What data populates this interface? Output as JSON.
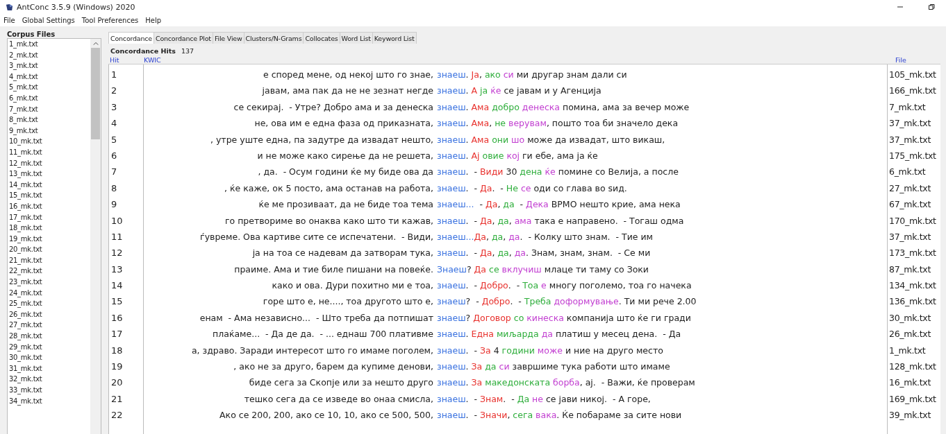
{
  "window": {
    "title": "AntConc 3.5.9 (Windows) 2020"
  },
  "menu": [
    "File",
    "Global Settings",
    "Tool Preferences",
    "Help"
  ],
  "corpus_files": {
    "title": "Corpus Files",
    "items": [
      "1_mk.txt",
      "2_mk.txt",
      "3_mk.txt",
      "4_mk.txt",
      "5_mk.txt",
      "6_mk.txt",
      "7_mk.txt",
      "8_mk.txt",
      "9_mk.txt",
      "10_mk.txt",
      "11_mk.txt",
      "12_mk.txt",
      "13_mk.txt",
      "14_mk.txt",
      "15_mk.txt",
      "16_mk.txt",
      "17_mk.txt",
      "18_mk.txt",
      "19_mk.txt",
      "20_mk.txt",
      "21_mk.txt",
      "22_mk.txt",
      "23_mk.txt",
      "24_mk.txt",
      "25_mk.txt",
      "26_mk.txt",
      "27_mk.txt",
      "28_mk.txt",
      "29_mk.txt",
      "30_mk.txt",
      "31_mk.txt",
      "32_mk.txt",
      "33_mk.txt",
      "34_mk.txt"
    ]
  },
  "tabs": [
    {
      "label": "Concordance",
      "selected": true
    },
    {
      "label": "Concordance Plot",
      "selected": false
    },
    {
      "label": "File View",
      "selected": false
    },
    {
      "label": "Clusters/N-Grams",
      "selected": false
    },
    {
      "label": "Collocates",
      "selected": false
    },
    {
      "label": "Word List",
      "selected": false
    },
    {
      "label": "Keyword List",
      "selected": false
    }
  ],
  "hits": {
    "label": "Concordance Hits",
    "count": "137"
  },
  "columns": [
    "Hit",
    "KWIC",
    "File"
  ],
  "rows": [
    {
      "hit": "1",
      "left": "е според мене, од некој што го знае,",
      "node": "знаеш",
      "file": "105_mk.txt",
      "right": [
        {
          "text": ". "
        },
        {
          "text": "Ја",
          "color": "#e8322e"
        },
        {
          "text": ", "
        },
        {
          "text": "ако",
          "color": "#2fae3c"
        },
        {
          "text": " си",
          "color": "#c23fd1"
        },
        {
          "text": " ми другар знам дали си"
        }
      ]
    },
    {
      "hit": "2",
      "left": "јавам, ама пак да не не зезнат негде",
      "node": "знаеш",
      "file": "166_mk.txt",
      "right": [
        {
          "text": ". "
        },
        {
          "text": "А",
          "color": "#e8322e"
        },
        {
          "text": " ја",
          "color": "#2fae3c"
        },
        {
          "text": " ќе",
          "color": "#c23fd1"
        },
        {
          "text": " се јавам и у Агенција"
        }
      ]
    },
    {
      "hit": "3",
      "left": "се секирај.  - Утре? Добро ама и за денеска",
      "node": "знаеш",
      "file": "7_mk.txt",
      "right": [
        {
          "text": ". "
        },
        {
          "text": "Ама",
          "color": "#e8322e"
        },
        {
          "text": " добро",
          "color": "#2fae3c"
        },
        {
          "text": " денеска",
          "color": "#c23fd1"
        },
        {
          "text": " помина, ама за вечер може"
        }
      ]
    },
    {
      "hit": "4",
      "left": "не, ова им е една фаза од приказната,",
      "node": "знаеш",
      "file": "37_mk.txt",
      "right": [
        {
          "text": ". "
        },
        {
          "text": "Ама",
          "color": "#e8322e"
        },
        {
          "text": ", "
        },
        {
          "text": "не",
          "color": "#2fae3c"
        },
        {
          "text": " верувам",
          "color": "#c23fd1"
        },
        {
          "text": ", пошто тоа би значело дека"
        }
      ]
    },
    {
      "hit": "5",
      "left": ", утре уште една, па задутре да извадат нешто,",
      "node": "знаеш",
      "file": "37_mk.txt",
      "right": [
        {
          "text": ". "
        },
        {
          "text": "Ама",
          "color": "#e8322e"
        },
        {
          "text": " они",
          "color": "#2fae3c"
        },
        {
          "text": " шо",
          "color": "#c23fd1"
        },
        {
          "text": " може да извадат, што викаш,"
        }
      ]
    },
    {
      "hit": "6",
      "left": "и не може како сирење да не решета,",
      "node": "знаеш",
      "file": "175_mk.txt",
      "right": [
        {
          "text": ". "
        },
        {
          "text": "Ај",
          "color": "#e8322e"
        },
        {
          "text": " овие",
          "color": "#2fae3c"
        },
        {
          "text": " кој",
          "color": "#c23fd1"
        },
        {
          "text": " ги ебе, ама ја ќе"
        }
      ]
    },
    {
      "hit": "7",
      "left": ", да.  - Осум години ќе му биде ова да",
      "node": "знаеш",
      "file": "6_mk.txt",
      "right": [
        {
          "text": ".  - "
        },
        {
          "text": "Види",
          "color": "#e8322e"
        },
        {
          "text": " 30 "
        },
        {
          "text": "дена",
          "color": "#2fae3c"
        },
        {
          "text": " ќе",
          "color": "#c23fd1"
        },
        {
          "text": " помине со Велија, а после"
        }
      ]
    },
    {
      "hit": "8",
      "left": ", ќе каже, ок 5 посто, ама останав на работа,",
      "node": "знаеш",
      "file": "27_mk.txt",
      "right": [
        {
          "text": ".  - "
        },
        {
          "text": "Да",
          "color": "#e8322e"
        },
        {
          "text": ".  - "
        },
        {
          "text": "Не",
          "color": "#2fae3c"
        },
        {
          "text": " се",
          "color": "#c23fd1"
        },
        {
          "text": " оди со глава во ѕид."
        }
      ]
    },
    {
      "hit": "9",
      "left": "ќе ме прозиваат, да не биде тоа тема",
      "node": "знаеш...",
      "file": "67_mk.txt",
      "right": [
        {
          "text": "  - "
        },
        {
          "text": "Да",
          "color": "#e8322e"
        },
        {
          "text": ", "
        },
        {
          "text": "да",
          "color": "#2fae3c"
        },
        {
          "text": "  - "
        },
        {
          "text": "Дека",
          "color": "#c23fd1"
        },
        {
          "text": " ВРМО нешто крие, ама нека"
        }
      ]
    },
    {
      "hit": "10",
      "left": "го претвориме во онаква како што ти кажав,",
      "node": "знаеш",
      "file": "170_mk.txt",
      "right": [
        {
          "text": ".  - "
        },
        {
          "text": "Да",
          "color": "#e8322e"
        },
        {
          "text": ", "
        },
        {
          "text": "да",
          "color": "#2fae3c"
        },
        {
          "text": ", "
        },
        {
          "text": "ама",
          "color": "#c23fd1"
        },
        {
          "text": " така е направено.  - Тогаш одма"
        }
      ]
    },
    {
      "hit": "11",
      "left": "ѓувреме. Ова картиве сите се испечатени.  - Види,",
      "node": "знаеш...",
      "file": "37_mk.txt",
      "right": [
        {
          "text": "Да",
          "color": "#e8322e"
        },
        {
          "text": ", "
        },
        {
          "text": "да",
          "color": "#2fae3c"
        },
        {
          "text": ", "
        },
        {
          "text": "да",
          "color": "#c23fd1"
        },
        {
          "text": ".  - Колку што знам.  - Тие им"
        }
      ]
    },
    {
      "hit": "12",
      "left": "ја на тоа се надевам да затворам тука,",
      "node": "знаеш",
      "file": "173_mk.txt",
      "right": [
        {
          "text": ".  - "
        },
        {
          "text": "Да",
          "color": "#e8322e"
        },
        {
          "text": ", "
        },
        {
          "text": "да",
          "color": "#2fae3c"
        },
        {
          "text": ", "
        },
        {
          "text": "да",
          "color": "#c23fd1"
        },
        {
          "text": ". Знам, знам, знам.  - Се ми"
        }
      ]
    },
    {
      "hit": "13",
      "left": "праиме. Ама и тие биле пишани на повеќе.",
      "node": "Знаеш",
      "file": "87_mk.txt",
      "right": [
        {
          "text": "? "
        },
        {
          "text": "Да",
          "color": "#e8322e"
        },
        {
          "text": " се",
          "color": "#2fae3c"
        },
        {
          "text": " вклучиш",
          "color": "#c23fd1"
        },
        {
          "text": " млаце ти таму со Зоки"
        }
      ]
    },
    {
      "hit": "14",
      "left": "како и ова. Дури похитно ми е тоа,",
      "node": "знаеш",
      "file": "134_mk.txt",
      "right": [
        {
          "text": ".  - "
        },
        {
          "text": "Добро",
          "color": "#e8322e"
        },
        {
          "text": ".  - "
        },
        {
          "text": "Тоа",
          "color": "#2fae3c"
        },
        {
          "text": " е",
          "color": "#c23fd1"
        },
        {
          "text": " многу поголемо, тоа го начека"
        }
      ]
    },
    {
      "hit": "15",
      "left": "горе што е, не...., тоа другото што е,",
      "node": "знаеш",
      "file": "136_mk.txt",
      "right": [
        {
          "text": "?  - "
        },
        {
          "text": "Добро",
          "color": "#e8322e"
        },
        {
          "text": ".  - "
        },
        {
          "text": "Треба",
          "color": "#2fae3c"
        },
        {
          "text": " доформување",
          "color": "#c23fd1"
        },
        {
          "text": ". Ти ми рече 2.00"
        }
      ]
    },
    {
      "hit": "16",
      "left": "енам  - Ама независно...  - Што треба да потпишат",
      "node": "знаеш",
      "file": "30_mk.txt",
      "right": [
        {
          "text": "? "
        },
        {
          "text": "Договор",
          "color": "#e8322e"
        },
        {
          "text": " со",
          "color": "#2fae3c"
        },
        {
          "text": " кинеска",
          "color": "#c23fd1"
        },
        {
          "text": " компанија што ќе ги гради"
        }
      ]
    },
    {
      "hit": "17",
      "left": "плаќаме...  - Да де да.  - ... еднаш 700 плативме",
      "node": "знаеш",
      "file": "26_mk.txt",
      "right": [
        {
          "text": ". "
        },
        {
          "text": "Една",
          "color": "#e8322e"
        },
        {
          "text": " миљарда",
          "color": "#2fae3c"
        },
        {
          "text": " да",
          "color": "#c23fd1"
        },
        {
          "text": " платиш у месец дена.  - Да"
        }
      ]
    },
    {
      "hit": "18",
      "left": "а, здраво. Заради интересот што го имаме поголем,",
      "node": "знаеш",
      "file": "1_mk.txt",
      "right": [
        {
          "text": ".  - "
        },
        {
          "text": "За",
          "color": "#e8322e"
        },
        {
          "text": " 4 "
        },
        {
          "text": "години",
          "color": "#2fae3c"
        },
        {
          "text": " може",
          "color": "#c23fd1"
        },
        {
          "text": " и ние на друго место"
        }
      ]
    },
    {
      "hit": "19",
      "left": ", ако не за друго, барем да купиме денови,",
      "node": "знаеш",
      "file": "128_mk.txt",
      "right": [
        {
          "text": ". "
        },
        {
          "text": "За",
          "color": "#e8322e"
        },
        {
          "text": " да",
          "color": "#2fae3c"
        },
        {
          "text": " си",
          "color": "#c23fd1"
        },
        {
          "text": " завршиме тука работи што имаме"
        }
      ]
    },
    {
      "hit": "20",
      "left": "биде сега за Скопје или за нешто друго",
      "node": "знаеш",
      "file": "16_mk.txt",
      "right": [
        {
          "text": ". "
        },
        {
          "text": "За",
          "color": "#e8322e"
        },
        {
          "text": " македонската",
          "color": "#2fae3c"
        },
        {
          "text": " борба",
          "color": "#c23fd1"
        },
        {
          "text": ", ај.  - Важи, ќе проверам"
        }
      ]
    },
    {
      "hit": "21",
      "left": "тешко сега да се изведе во онаа смисла,",
      "node": "знаеш",
      "file": "169_mk.txt",
      "right": [
        {
          "text": ".  - "
        },
        {
          "text": "Знам",
          "color": "#e8322e"
        },
        {
          "text": ".  - "
        },
        {
          "text": "Да",
          "color": "#2fae3c"
        },
        {
          "text": " не",
          "color": "#c23fd1"
        },
        {
          "text": " се јави никој.  - А горе,"
        }
      ]
    },
    {
      "hit": "22",
      "left": "Ако се 200, 200, ако се 10, 10, ако се 500, 500,",
      "node": "знаеш",
      "file": "39_mk.txt",
      "right": [
        {
          "text": ".  - "
        },
        {
          "text": "Значи",
          "color": "#e8322e"
        },
        {
          "text": ", "
        },
        {
          "text": "сега",
          "color": "#2fae3c"
        },
        {
          "text": " вака",
          "color": "#c23fd1"
        },
        {
          "text": ". Ќе побараме за сите нови"
        }
      ]
    }
  ]
}
